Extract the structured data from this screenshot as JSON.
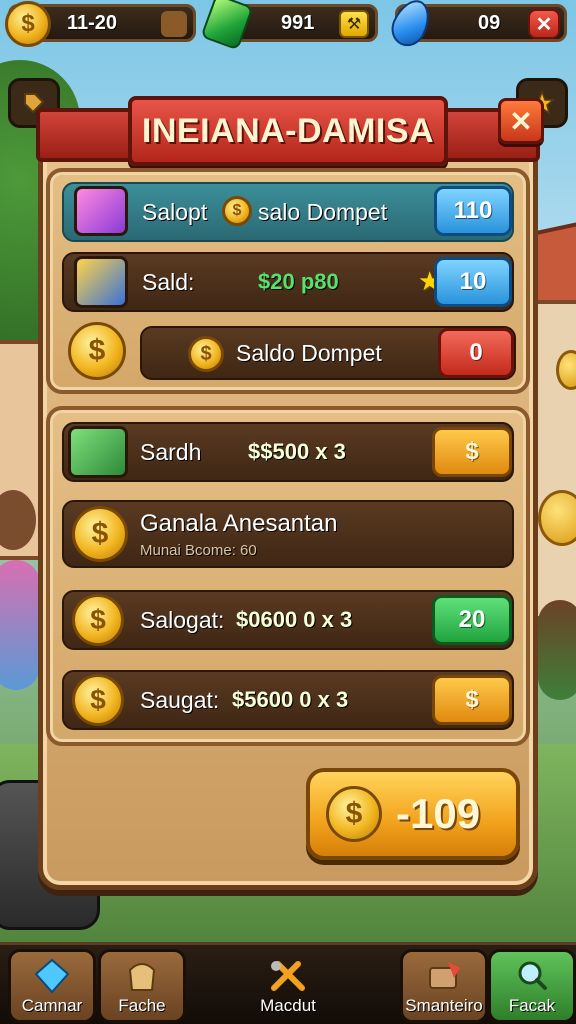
{
  "top_bar": {
    "coins": "11-20",
    "gems": "991",
    "crystals": "09",
    "coin_symbol": "$",
    "tools_symbol": "⚒",
    "close_symbol": "✕"
  },
  "dialog": {
    "title": "INEIANA-DAMISA",
    "close_symbol": "✕",
    "rows": [
      {
        "label": "Salopt",
        "label2": "salo Dompet",
        "button": "110",
        "button_color": "blue"
      },
      {
        "label": "Sald:",
        "amount": "$20 p80",
        "button": "10",
        "button_color": "blue"
      },
      {
        "label": "Saldo Dompet",
        "button": "0",
        "button_color": "red"
      }
    ],
    "rewards": [
      {
        "label": "Sardh",
        "amount": "$$500 x 3",
        "button": "$",
        "button_color": "orange"
      },
      {
        "label": "Ganala Anesantan",
        "sublabel": "Munai Bcome: 60"
      },
      {
        "label": "Salogat:",
        "amount": "$0600 0 x 3",
        "button": "20",
        "button_color": "green"
      },
      {
        "label": "Saugat:",
        "amount": "$5600 0 x 3",
        "button": "$",
        "button_color": "orange"
      }
    ],
    "collect_value": "-109",
    "coin_symbol": "$"
  },
  "bottom_nav": [
    {
      "label": "Camnar",
      "icon": "gem-icon"
    },
    {
      "label": "Fache",
      "icon": "bag-icon"
    },
    {
      "label": "Macdut",
      "icon": "tools-icon"
    },
    {
      "label": "Smanteiro",
      "icon": "book-icon"
    },
    {
      "label": "Facak",
      "icon": "search-icon"
    }
  ],
  "colors": {
    "panel": "#d6ab72",
    "banner": "#c22a1c",
    "accent_gold": "#f2b620",
    "button_blue": "#2a93dc",
    "button_green": "#21a43e",
    "button_orange": "#e08a10",
    "button_red": "#c22a1c"
  }
}
